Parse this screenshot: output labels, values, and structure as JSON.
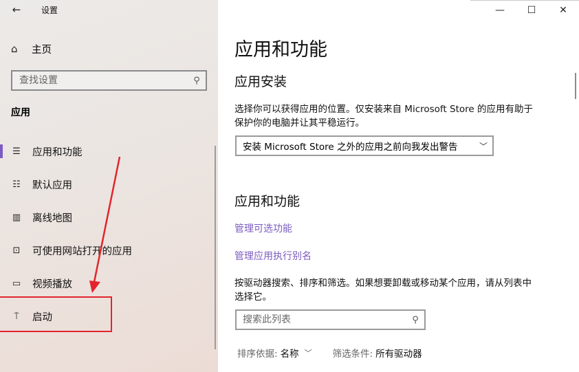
{
  "window": {
    "title": "设置",
    "back_icon": "back-arrow-icon",
    "minimize": "—",
    "maximize": "☐",
    "close": "✕"
  },
  "sidebar": {
    "home_label": "主页",
    "search_placeholder": "查找设置",
    "section_title": "应用",
    "items": [
      {
        "label": "应用和功能",
        "icon": "apps-list-icon",
        "selected": true
      },
      {
        "label": "默认应用",
        "icon": "default-apps-icon",
        "selected": false
      },
      {
        "label": "离线地图",
        "icon": "offline-map-icon",
        "selected": false
      },
      {
        "label": "可使用网站打开的应用",
        "icon": "website-apps-icon",
        "selected": false
      },
      {
        "label": "视频播放",
        "icon": "video-playback-icon",
        "selected": false
      },
      {
        "label": "启动",
        "icon": "startup-icon",
        "selected": false
      }
    ]
  },
  "main": {
    "title": "应用和功能",
    "install_heading": "应用安装",
    "install_desc": "选择你可以获得应用的位置。仅安装来自 Microsoft Store 的应用有助于保护你的电脑并让其平稳运行。",
    "install_dropdown_value": "安装 Microsoft Store 之外的应用之前向我发出警告",
    "apps_heading": "应用和功能",
    "link_optional_features": "管理可选功能",
    "link_app_aliases": "管理应用执行别名",
    "filter_desc": "按驱动器搜索、排序和筛选。如果想要卸载或移动某个应用，请从列表中选择它。",
    "search_list_placeholder": "搜索此列表",
    "sort_label": "排序依据:",
    "sort_value": "名称",
    "filter_label": "筛选条件:",
    "filter_value": "所有驱动器"
  },
  "colors": {
    "accent": "#7c5cc4",
    "link": "#7b5bbf",
    "annotation": "#e2242c"
  }
}
